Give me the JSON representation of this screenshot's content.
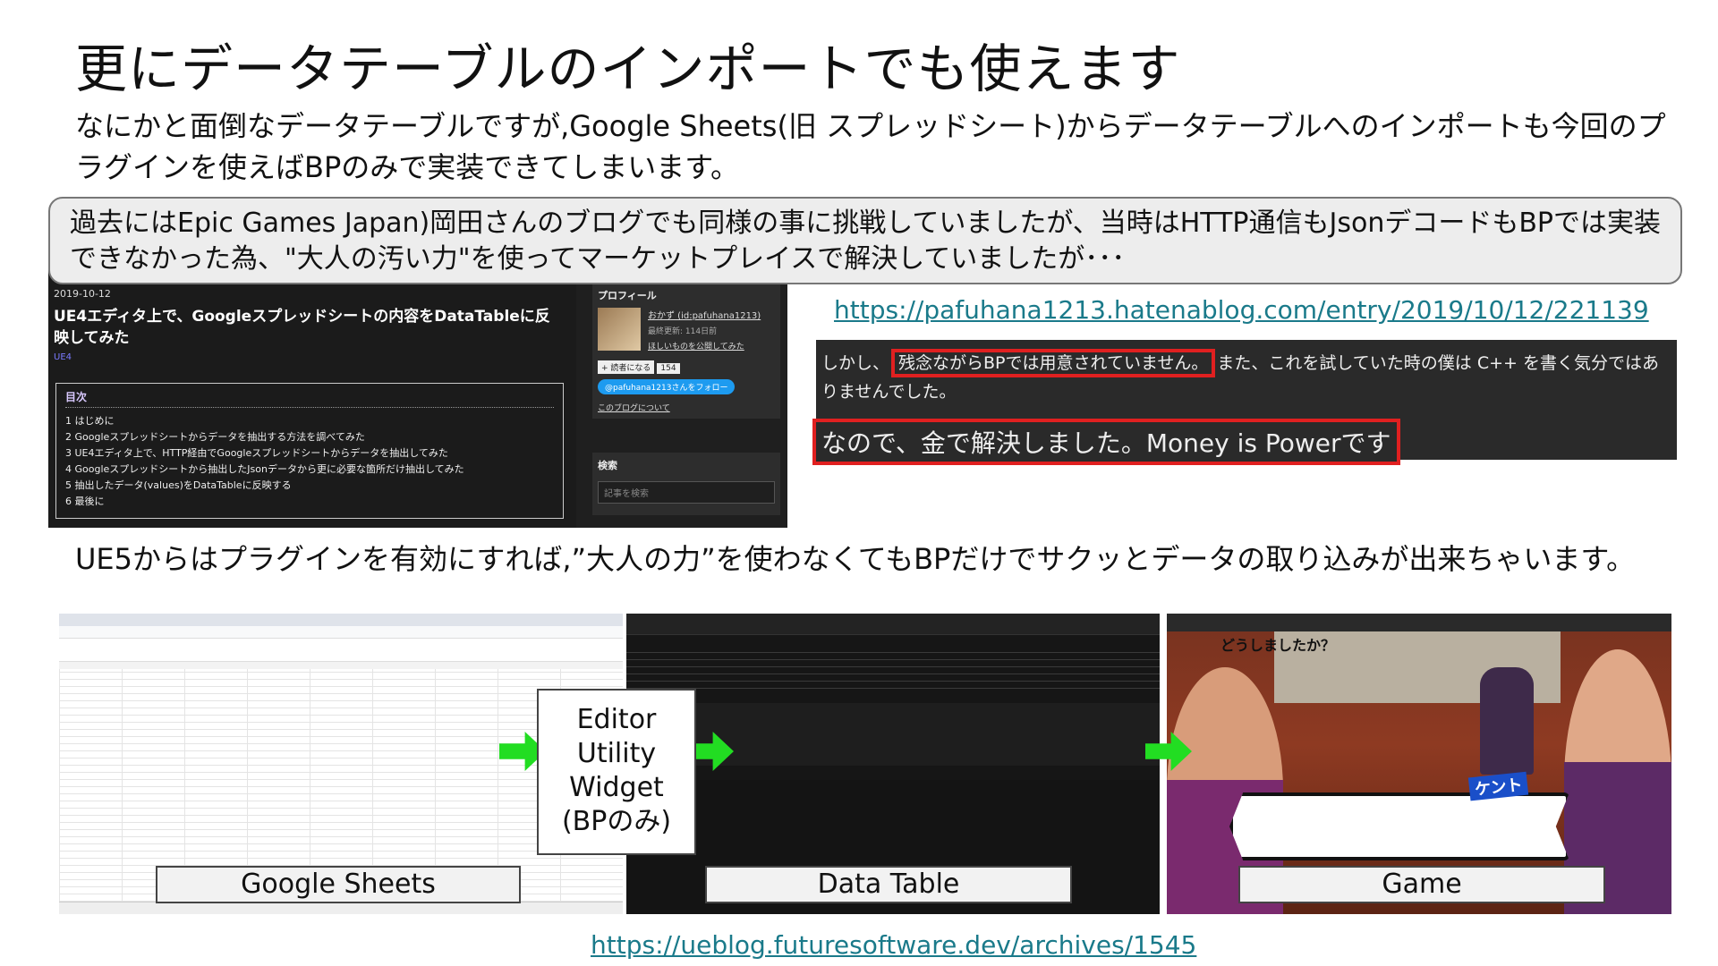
{
  "slide": {
    "title": "更にデータテーブルのインポートでも使えます",
    "intro": "なにかと面倒なデータテーブルですが,Google Sheets(旧 スプレッドシート)からデータテーブルへのインポートも今回のプラグインを使えばBPのみで実装できてしまいます。",
    "callout": "過去にはEpic Games Japan)岡田さんのブログでも同様の事に挑戦していましたが、当時はHTTP通信もJsonデコードもBPでは実装できなかった為、\"大人の汚い力\"を使ってマーケットプレイスで解決していましたが･･･",
    "ue5_text": "UE5からはプラグインを有効にすれば,”大人の力”を使わなくてもBPだけでサクッとデータの取り込みが出来ちゃいます。",
    "link1": "https://pafuhana1213.hatenablog.com/entry/2019/10/12/221139",
    "link2": "https://ueblog.futuresoftware.dev/archives/1545"
  },
  "blog": {
    "date": "2019-10-12",
    "title": "UE4エディタ上で、Googleスプレッドシートの内容をDataTableに反映してみた",
    "category": "UE4",
    "toc_heading": "目次",
    "toc": [
      "1 はじめに",
      "2 Googleスプレッドシートからデータを抽出する方法を調べてみた",
      "3 UE4エディタ上で、HTTP経由でGoogleスプレッドシートからデータを抽出してみた",
      "4 Googleスプレッドシートから抽出したJsonデータから更に必要な箇所だけ抽出してみた",
      "5 抽出したデータ(values)をDataTableに反映する",
      "6 最後に"
    ],
    "profile_heading": "プロフィール",
    "profile_name": "おかず (id:pafuhana1213)",
    "profile_updated": "最終更新: 114日前",
    "profile_link": "ほしいものを公開してみた",
    "reader_label": "+ 読者になる",
    "reader_count": "154",
    "follow_label": "@pafuhana1213さんをフォロー",
    "about_link": "このブログについて",
    "search_heading": "検索",
    "search_placeholder": "記事を検索"
  },
  "quote": {
    "pre": "しかし、",
    "highlight": "残念ながらBPでは用意されていません。",
    "post": "また、これを試していた時の僕は C++ を書く気分ではありませんでした。",
    "line2": "なので、金で解決しました。Money is Powerです"
  },
  "pipeline": {
    "sheets_label": "Google Sheets",
    "widget_label": "Editor\nUtility\nWidget\n(BPのみ)",
    "datatable_label": "Data Table",
    "game_label": "Game"
  },
  "game": {
    "speaker": "ケント",
    "dialog": "どうしましたか？"
  },
  "colors": {
    "link": "#1a7a8a",
    "highlight_border": "#e02020",
    "arrow": "#22dd22"
  }
}
